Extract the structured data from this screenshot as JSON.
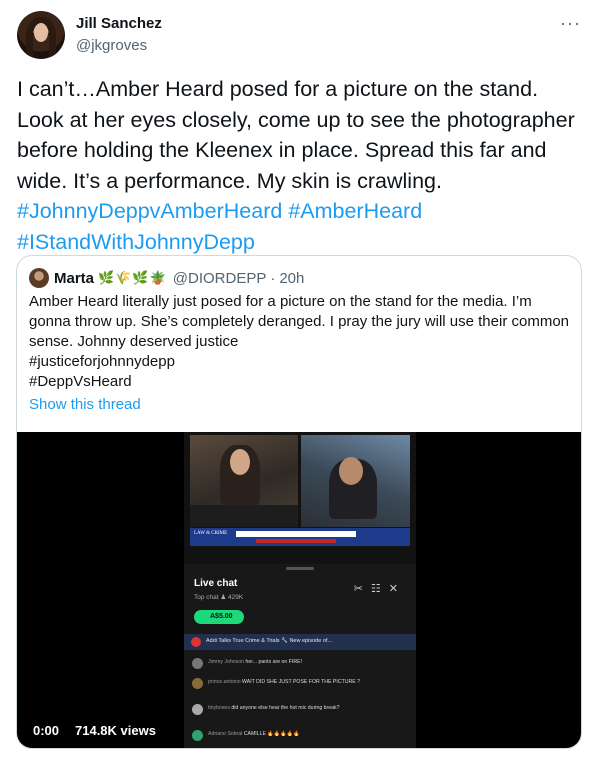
{
  "author": {
    "name": "Jill Sanchez",
    "handle": "@jkgroves",
    "more_icon": "ellipsis-icon"
  },
  "tweet": {
    "text_plain": "I can’t…Amber Heard posed for a picture on the stand. Look at her eyes closely, come up to see the photographer before holding the Kleenex in place. Spread this far and wide. It’s a performance. My skin is crawling. ",
    "hashtags": [
      "#JohnnyDeppvAmberHeard",
      "#AmberHeard",
      "#IStandWithJohnnyDepp"
    ]
  },
  "quote": {
    "name": "Marta",
    "emojis": "🌿🌾🌿🪴",
    "handle": "@DIORDEPP",
    "separator": "·",
    "time": "20h",
    "lines": [
      "Amber Heard literally just posed for a picture on the stand for the media. I’m",
      "gonna throw up. She’s completely deranged. I pray the jury will use their common",
      "sense. Johnny deserved justice",
      "#justiceforjohnnydepp",
      "#DeppVsHeard"
    ],
    "show_thread": "Show this thread"
  },
  "video": {
    "timestamp": "0:00",
    "views": "714.8K views",
    "overlay": {
      "logo": "LAW & CRIME",
      "live_chat_title": "Live chat",
      "top_chat": "Top chat  ♟  429K",
      "donation": "A$5.00",
      "pinned": "Addi Talks True Crime & Trials 🔧  New episode of...",
      "messages": [
        {
          "user": "Jimmy Johnson",
          "text": "her... pants are on FIRE!"
        },
        {
          "user": "prince.antonio",
          "text": "WAIT DID SHE JUST POSE FOR THE PICTURE ?"
        },
        {
          "user": "tinyboxes",
          "text": "did anyone else hear the hot mic during break?"
        },
        {
          "user": "Adriano Sobral",
          "text": "CAMILLE 🔥🔥🔥🔥🔥"
        }
      ]
    }
  }
}
